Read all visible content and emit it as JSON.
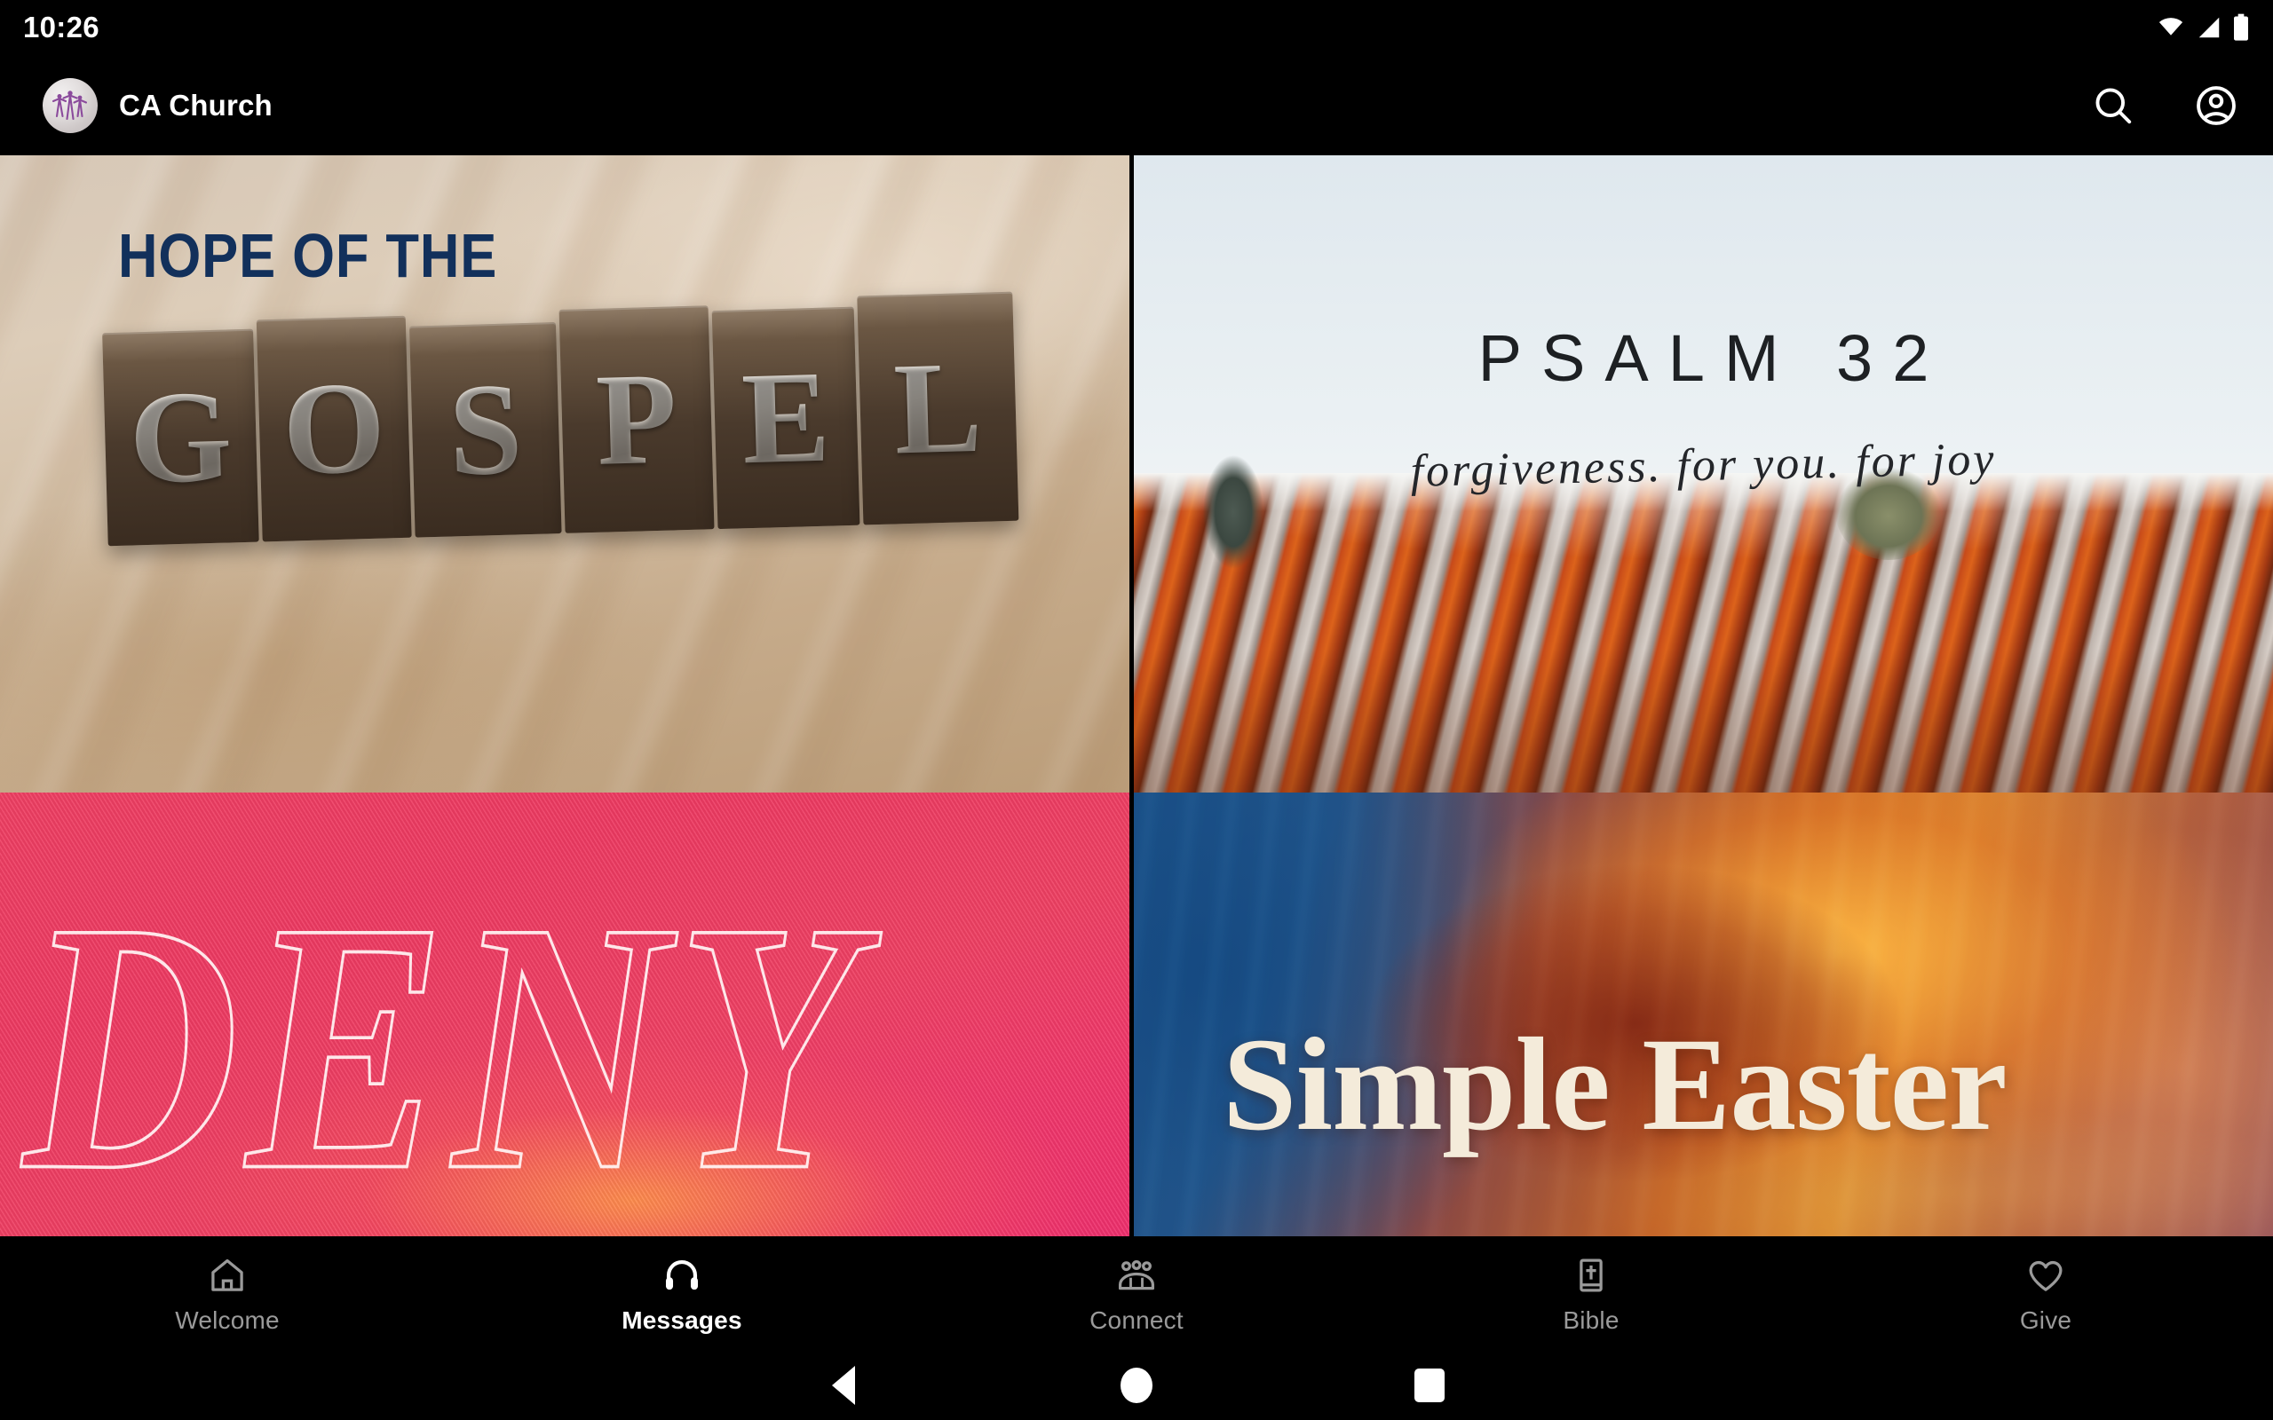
{
  "status_bar": {
    "time": "10:26",
    "icons": [
      "wifi-icon",
      "cellular-signal-icon",
      "battery-icon"
    ]
  },
  "header": {
    "app_title": "CA Church",
    "logo_name": "ca-church-logo",
    "actions": [
      {
        "name": "search-icon",
        "label": "Search"
      },
      {
        "name": "account-icon",
        "label": "Account"
      }
    ]
  },
  "content": {
    "tiles": [
      {
        "id": "hope-of-the-gospel",
        "headline": "HOPE OF THE",
        "word": "GOSPEL",
        "letters": [
          "G",
          "O",
          "S",
          "P",
          "E",
          "L"
        ],
        "headline_color": "#12305b",
        "background": "#d3bfa6"
      },
      {
        "id": "psalm-32",
        "title": "PSALM 32",
        "subtitle": "forgiveness. for you. for joy",
        "title_color": "#1d2023",
        "background": "#eaf0f3"
      },
      {
        "id": "deny",
        "title": "DENY",
        "title_color": "#fff5f5",
        "background": "#ef3f63"
      },
      {
        "id": "simple-easter",
        "title": "Simple Easter",
        "title_color": "#f4ebda",
        "background": "#c4662a"
      }
    ]
  },
  "bottom_nav": {
    "active": "Messages",
    "items": [
      {
        "label": "Welcome",
        "icon": "home-icon",
        "active": false
      },
      {
        "label": "Messages",
        "icon": "headphones-icon",
        "active": true
      },
      {
        "label": "Connect",
        "icon": "people-group-icon",
        "active": false
      },
      {
        "label": "Bible",
        "icon": "bible-book-icon",
        "active": false
      },
      {
        "label": "Give",
        "icon": "heart-icon",
        "active": false
      }
    ],
    "active_color": "#ffffff",
    "inactive_color": "#9a9a9a"
  },
  "system_nav": {
    "buttons": [
      {
        "name": "back-button",
        "icon": "triangle-back-icon"
      },
      {
        "name": "home-button",
        "icon": "circle-home-icon"
      },
      {
        "name": "recents-button",
        "icon": "square-recents-icon"
      }
    ]
  }
}
